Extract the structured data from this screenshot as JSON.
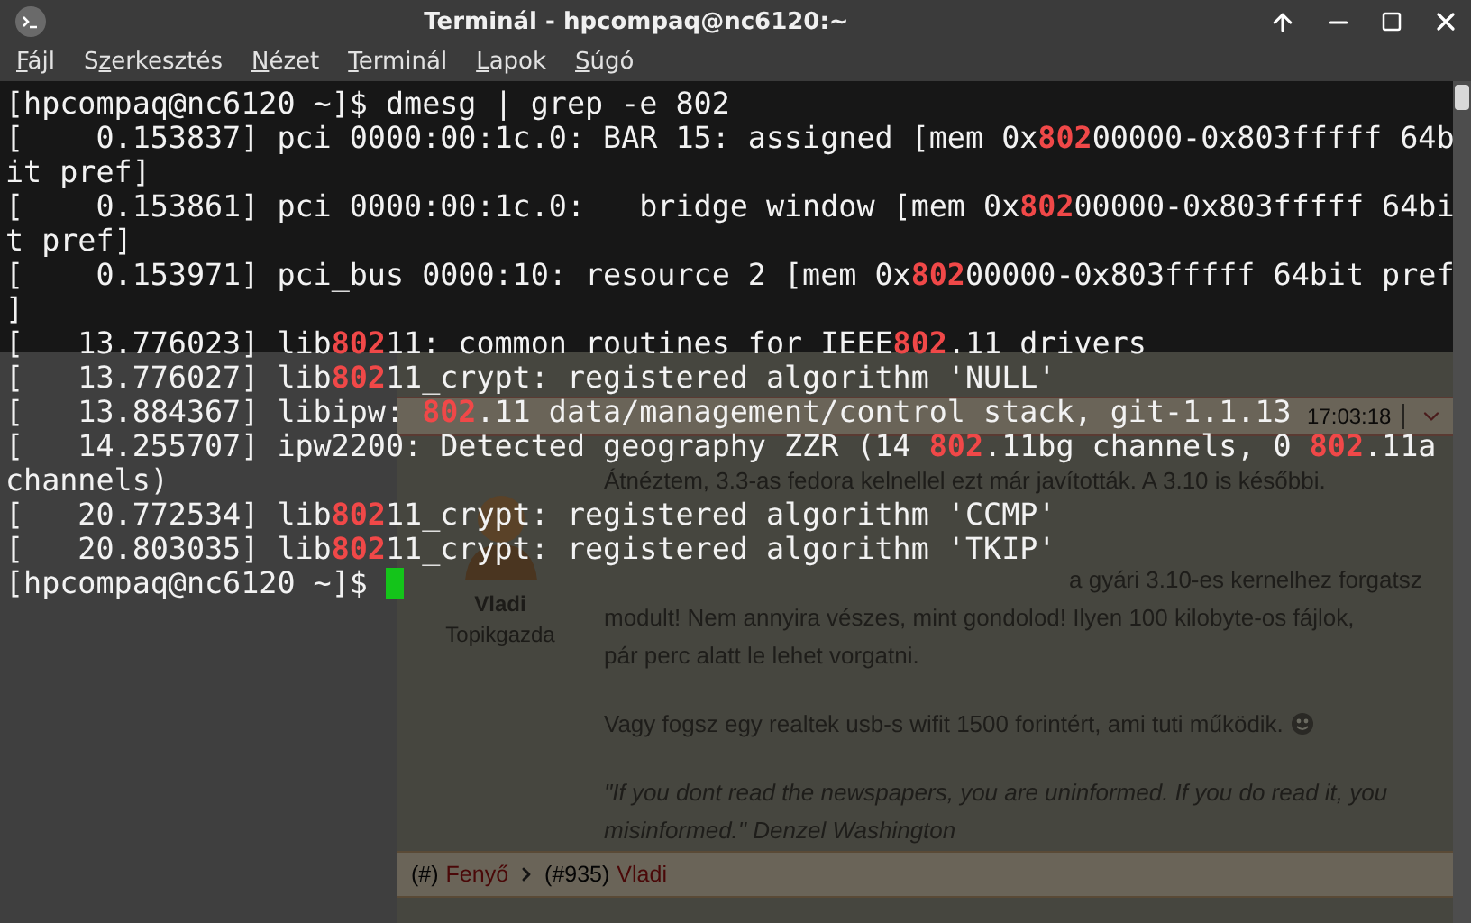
{
  "window": {
    "title": "Terminál - hpcompaq@nc6120:~"
  },
  "menu": [
    {
      "key": "F",
      "post": "ájl"
    },
    {
      "pre": "S",
      "key": "z",
      "post": "erkesztés"
    },
    {
      "key": "N",
      "post": "ézet"
    },
    {
      "key": "T",
      "post": "erminál"
    },
    {
      "key": "L",
      "post": "apok"
    },
    {
      "key": "S",
      "post": "úgó"
    }
  ],
  "background_page": {
    "post_time": "17:03:18",
    "author": "Vladi",
    "author_role": "Topikgazda",
    "paragraphs": [
      {
        "kind": "text",
        "lines": [
          "Átnéztem, 3.3-as fedora kelnellel ezt már javították. A 3.10 is későbbi."
        ]
      },
      {
        "kind": "partial",
        "lines": [
          "a gyári 3.10-es kernelhez forgatsz",
          "modult! Nem annyira vészes, mint gondolod! Ilyen 100 kilobyte-os fájlok,",
          "pár perc alatt le lehet vorgatni."
        ]
      },
      {
        "kind": "text",
        "lines": [
          "Vagy fogsz egy realtek usb-s wifit 1500 forintért, ami tuti működik."
        ],
        "smiley": true
      },
      {
        "kind": "quote",
        "lines": [
          "\"If you dont read the newspapers, you are uninformed. If you do read it, you",
          "misinformed.\" Denzel Washington"
        ]
      }
    ],
    "footer": [
      {
        "text": "(#)",
        "link": false
      },
      {
        "text": "Fenyő",
        "link": true
      },
      {
        "text": "(#935)",
        "link": false,
        "arrow_before": true
      },
      {
        "text": "Vladi",
        "link": true
      }
    ]
  },
  "terminal": {
    "lines": [
      {
        "kind": "prompt",
        "prompt": "[hpcompaq@nc6120 ~]$ ",
        "command": "dmesg | grep -e 802",
        "cursor": false
      },
      {
        "kind": "output",
        "parts": [
          {
            "text": "[    0.153837] pci 0000:00:1c.0: BAR 15: assigned [mem 0x",
            "match": false
          },
          {
            "text": "802",
            "match": true
          },
          {
            "text": "00000-0x803fffff 64b",
            "match": false
          }
        ]
      },
      {
        "kind": "output",
        "parts": [
          {
            "text": "it pref]",
            "match": false
          }
        ]
      },
      {
        "kind": "output",
        "parts": [
          {
            "text": "[    0.153861] pci 0000:00:1c.0:   bridge window [mem 0x",
            "match": false
          },
          {
            "text": "802",
            "match": true
          },
          {
            "text": "00000-0x803fffff 64bi",
            "match": false
          }
        ]
      },
      {
        "kind": "output",
        "parts": [
          {
            "text": "t pref]",
            "match": false
          }
        ]
      },
      {
        "kind": "output",
        "parts": [
          {
            "text": "[    0.153971] pci_bus 0000:10: resource 2 [mem 0x",
            "match": false
          },
          {
            "text": "802",
            "match": true
          },
          {
            "text": "00000-0x803fffff 64bit pref",
            "match": false
          }
        ]
      },
      {
        "kind": "output",
        "parts": [
          {
            "text": "]",
            "match": false
          }
        ]
      },
      {
        "kind": "output",
        "parts": [
          {
            "text": "[   13.776023] lib",
            "match": false
          },
          {
            "text": "802",
            "match": true
          },
          {
            "text": "11: common routines for IEEE",
            "match": false
          },
          {
            "text": "802",
            "match": true
          },
          {
            "text": ".11 drivers",
            "match": false
          }
        ]
      },
      {
        "kind": "output",
        "parts": [
          {
            "text": "[   13.776027] lib",
            "match": false
          },
          {
            "text": "802",
            "match": true
          },
          {
            "text": "11_crypt: registered algorithm 'NULL'",
            "match": false
          }
        ]
      },
      {
        "kind": "output",
        "parts": [
          {
            "text": "[   13.884367] libipw: ",
            "match": false
          },
          {
            "text": "802",
            "match": true
          },
          {
            "text": ".11 data/management/control stack, git-1.1.13",
            "match": false
          }
        ]
      },
      {
        "kind": "output",
        "parts": [
          {
            "text": "[   14.255707] ipw2200: Detected geography ZZR (14 ",
            "match": false
          },
          {
            "text": "802",
            "match": true
          },
          {
            "text": ".11bg channels, 0 ",
            "match": false
          },
          {
            "text": "802",
            "match": true
          },
          {
            "text": ".11a",
            "match": false
          }
        ]
      },
      {
        "kind": "output",
        "parts": [
          {
            "text": "channels)",
            "match": false
          }
        ]
      },
      {
        "kind": "output",
        "parts": [
          {
            "text": "[   20.772534] lib",
            "match": false
          },
          {
            "text": "802",
            "match": true
          },
          {
            "text": "11_crypt: registered algorithm 'CCMP'",
            "match": false
          }
        ]
      },
      {
        "kind": "output",
        "parts": [
          {
            "text": "[   20.803035] lib",
            "match": false
          },
          {
            "text": "802",
            "match": true
          },
          {
            "text": "11_crypt: registered algorithm 'TKIP'",
            "match": false
          }
        ]
      },
      {
        "kind": "prompt",
        "prompt": "[hpcompaq@nc6120 ~]$ ",
        "cursor": true
      }
    ]
  }
}
